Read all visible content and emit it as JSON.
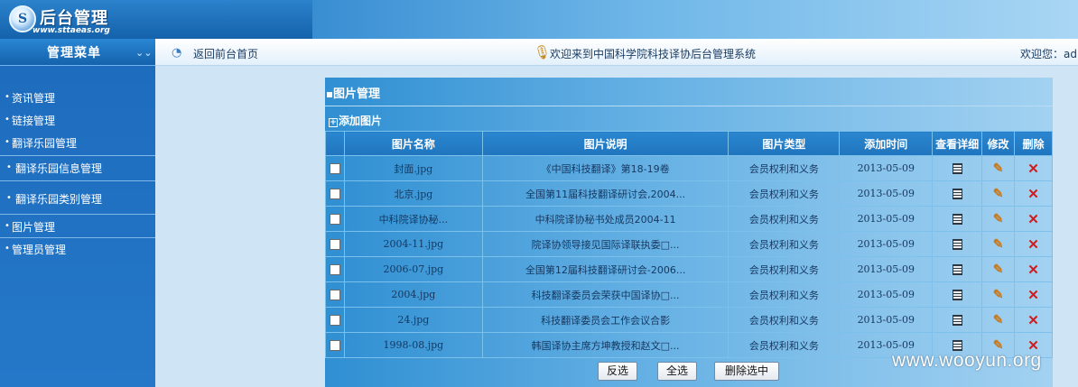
{
  "brand": {
    "title": "后台管理",
    "url": "www.sttaeas.org",
    "logo_mark": "S"
  },
  "sidebar": {
    "title": "管理菜单",
    "items": [
      {
        "label": "资讯管理"
      },
      {
        "label": "链接管理"
      },
      {
        "label": "翻译乐园管理"
      },
      {
        "label": "翻译乐园信息管理"
      },
      {
        "label": "翻译乐园类别管理"
      },
      {
        "label": "图片管理"
      },
      {
        "label": "管理员管理"
      }
    ]
  },
  "header": {
    "home_link": "返回前台首页",
    "welcome": "欢迎来到中国科学院科技译协后台管理系统",
    "user": "欢迎您：adm"
  },
  "panel": {
    "title": "图片管理",
    "add_label": "添加图片"
  },
  "table": {
    "columns": [
      "",
      "图片名称",
      "图片说明",
      "图片类型",
      "添加时间",
      "查看详细",
      "修改",
      "删除"
    ],
    "rows": [
      {
        "name": "封面.jpg",
        "desc": "《中国科技翻译》第18-19卷",
        "type": "会员权利和义务",
        "date": "2013-05-09"
      },
      {
        "name": "北京.jpg",
        "desc": "全国第11届科技翻译研讨会,2004...",
        "type": "会员权利和义务",
        "date": "2013-05-09"
      },
      {
        "name": "中科院译协秘...",
        "desc": "中科院译协秘书处成员2004-11",
        "type": "会员权利和义务",
        "date": "2013-05-09"
      },
      {
        "name": "2004-11.jpg",
        "desc": "院译协领导接见国际译联执委□...",
        "type": "会员权利和义务",
        "date": "2013-05-09"
      },
      {
        "name": "2006-07.jpg",
        "desc": "全国第12届科技翻译研讨会-2006...",
        "type": "会员权利和义务",
        "date": "2013-05-09"
      },
      {
        "name": "2004.jpg",
        "desc": "科技翻译委员会荣获中国译协□...",
        "type": "会员权利和义务",
        "date": "2013-05-09"
      },
      {
        "name": "24.jpg",
        "desc": "科技翻译委员会工作会议合影",
        "type": "会员权利和义务",
        "date": "2013-05-09"
      },
      {
        "name": "1998-08.jpg",
        "desc": "韩国译协主席方坤教授和赵文□...",
        "type": "会员权利和义务",
        "date": "2013-05-09"
      }
    ]
  },
  "buttons": {
    "invert": "反选",
    "select_all": "全选",
    "delete_selected": "删除选中"
  },
  "watermark": "www.wooyun.org",
  "colors": {
    "accent": "#1f75be",
    "delete": "#d21a1a",
    "edit": "#c77b1e"
  }
}
